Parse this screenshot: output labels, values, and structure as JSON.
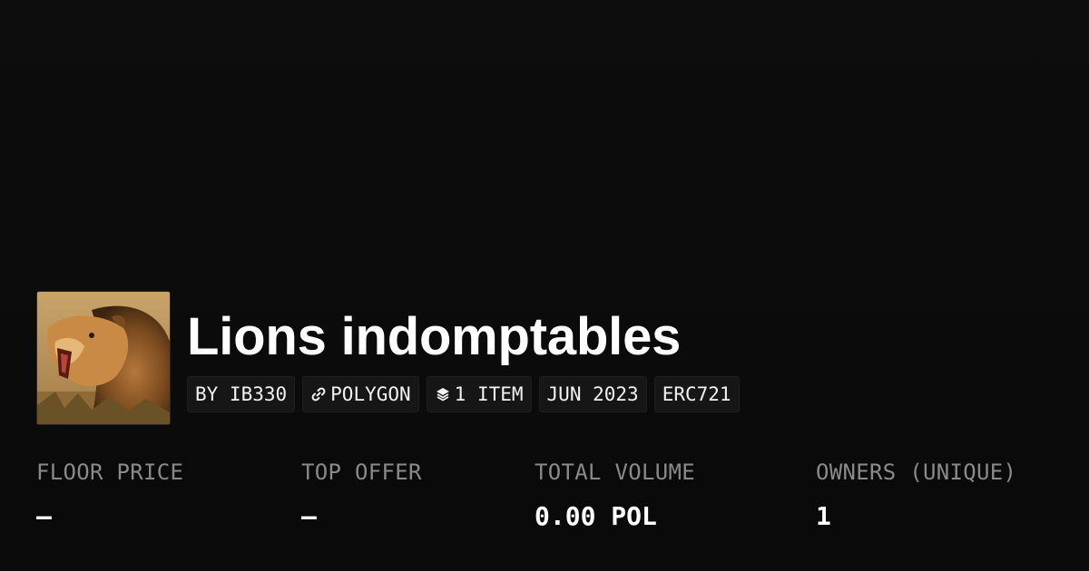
{
  "collection": {
    "name": "Lions indomptables",
    "avatar_icon": "lion-image"
  },
  "tags": [
    {
      "label": "BY IB330",
      "icon": ""
    },
    {
      "label": "POLYGON",
      "icon": "link-icon"
    },
    {
      "label": "1 ITEM",
      "icon": "layers-icon"
    },
    {
      "label": "JUN 2023",
      "icon": ""
    },
    {
      "label": "ERC721",
      "icon": ""
    }
  ],
  "stats": [
    {
      "label": "FLOOR PRICE",
      "value": "–"
    },
    {
      "label": "TOP OFFER",
      "value": "–"
    },
    {
      "label": "TOTAL VOLUME",
      "value": "0.00 POL"
    },
    {
      "label": "OWNERS (UNIQUE)",
      "value": "1"
    }
  ],
  "colors": {
    "background": "#0b0b0b",
    "tag_background": "#161616",
    "label": "#8a8a8a",
    "text": "#ffffff"
  }
}
